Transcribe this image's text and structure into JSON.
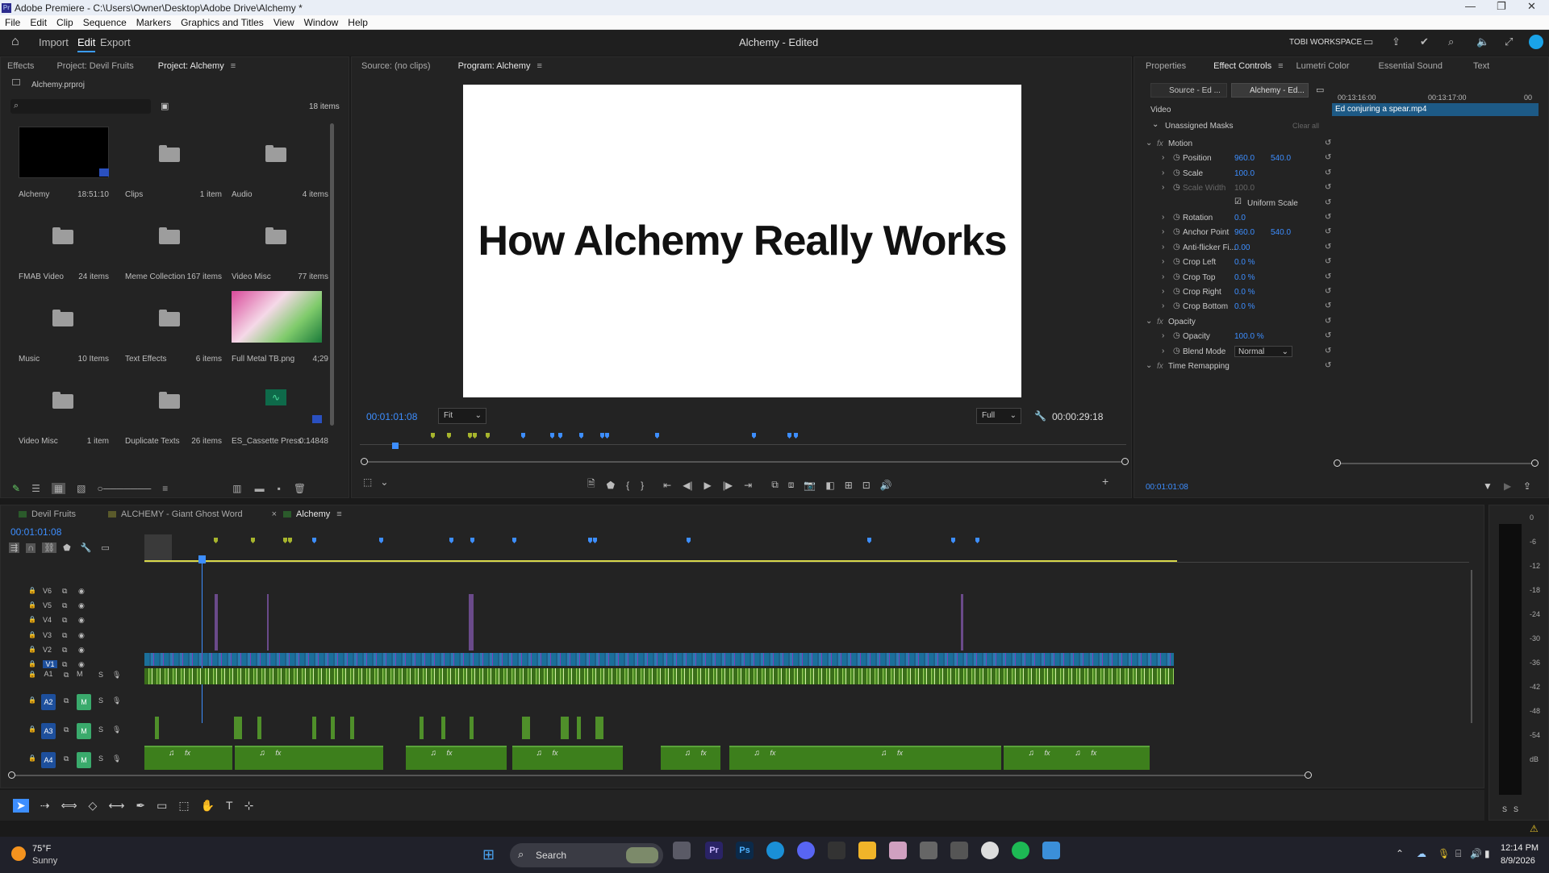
{
  "window": {
    "title": "Adobe Premiere - C:\\Users\\Owner\\Desktop\\Adobe Drive\\Alchemy *",
    "logo": "Pr"
  },
  "menu": [
    "File",
    "Edit",
    "Clip",
    "Sequence",
    "Markers",
    "Graphics and Titles",
    "View",
    "Window",
    "Help"
  ],
  "header": {
    "nav": [
      "Import",
      "Edit",
      "Export"
    ],
    "active": "Edit",
    "center": "Alchemy - Edited",
    "workspace": "TOBI WORKSPACE"
  },
  "project": {
    "tabs": [
      "Effects",
      "Project: Devil Fruits",
      "Project: Alchemy"
    ],
    "file": "Alchemy.prproj",
    "search_placeholder": "",
    "count": "18 items",
    "items": [
      {
        "name": "Alchemy",
        "count": "18:51:10",
        "type": "sequence"
      },
      {
        "name": "Clips",
        "count": "1 item",
        "type": "folder"
      },
      {
        "name": "Audio",
        "count": "4 items",
        "type": "folder"
      },
      {
        "name": "FMAB Video",
        "count": "24 items",
        "type": "folder"
      },
      {
        "name": "Meme Collection",
        "count": "167 items",
        "type": "folder"
      },
      {
        "name": "Video Misc",
        "count": "77 items",
        "type": "folder"
      },
      {
        "name": "Music",
        "count": "10 Items",
        "type": "folder"
      },
      {
        "name": "Text Effects",
        "count": "6 items",
        "type": "folder"
      },
      {
        "name": "Full Metal TB.png",
        "count": "4;29",
        "type": "image"
      },
      {
        "name": "Video Misc",
        "count": "1 item",
        "type": "folder"
      },
      {
        "name": "Duplicate Texts",
        "count": "26 items",
        "type": "folder"
      },
      {
        "name": "ES_Cassette Press ...",
        "count": "0:14848",
        "type": "audio"
      }
    ]
  },
  "monitor": {
    "tabs": [
      "Source: (no clips)",
      "Program: Alchemy"
    ],
    "title_text": "How Alchemy Really Works",
    "timecode": "00:01:01:08",
    "fit": "Fit",
    "full": "Full",
    "duration": "00:00:29:18"
  },
  "effect_controls": {
    "tabs": [
      "Properties",
      "Effect Controls",
      "Lumetri Color",
      "Essential Sound",
      "Text"
    ],
    "source_btn": "Source - Ed ...",
    "seq_btn": "Alchemy - Ed...",
    "time1": "00:13:16:00",
    "time2": "00:13:17:00",
    "time3": "00",
    "clip": "Ed conjuring a spear.mp4",
    "section": "Video",
    "masks": "Unassigned Masks",
    "clear": "Clear all",
    "rows": [
      {
        "label": "Motion",
        "fx": true,
        "v1": "",
        "v2": ""
      },
      {
        "label": "Position",
        "v1": "960.0",
        "v2": "540.0"
      },
      {
        "label": "Scale",
        "v1": "100.0",
        "v2": ""
      },
      {
        "label": "Scale Width",
        "v1": "100.0",
        "v2": "",
        "dim": true
      },
      {
        "label": "Uniform Scale",
        "v1": "",
        "v2": "",
        "check": true
      },
      {
        "label": "Rotation",
        "v1": "0.0",
        "v2": ""
      },
      {
        "label": "Anchor Point",
        "v1": "960.0",
        "v2": "540.0"
      },
      {
        "label": "Anti-flicker Fi...",
        "v1": "0.00",
        "v2": ""
      },
      {
        "label": "Crop Left",
        "v1": "0.0 %",
        "v2": ""
      },
      {
        "label": "Crop Top",
        "v1": "0.0 %",
        "v2": ""
      },
      {
        "label": "Crop Right",
        "v1": "0.0 %",
        "v2": ""
      },
      {
        "label": "Crop Bottom",
        "v1": "0.0 %",
        "v2": ""
      },
      {
        "label": "Opacity",
        "fx": true,
        "v1": "",
        "v2": ""
      },
      {
        "label": "Opacity",
        "v1": "100.0 %",
        "v2": ""
      },
      {
        "label": "Blend Mode",
        "v1": "Normal",
        "v2": "",
        "select": true
      },
      {
        "label": "Time Remapping",
        "fx": true,
        "v1": "",
        "v2": ""
      }
    ],
    "footer_time": "00:01:01:08"
  },
  "timeline": {
    "tabs": [
      "Devil Fruits",
      "ALCHEMY - Giant Ghost Word",
      "Alchemy"
    ],
    "timecode": "00:01:01:08",
    "video_tracks": [
      "V6",
      "V5",
      "V4",
      "V3",
      "V2",
      "V1"
    ],
    "audio_tracks": [
      "A1",
      "A2",
      "A3",
      "A4"
    ],
    "m": "M",
    "s": "S"
  },
  "meter": {
    "labels": [
      "0",
      "-6",
      "-12",
      "-18",
      "-24",
      "-30",
      "-36",
      "-42",
      "-48",
      "-54",
      "dB"
    ],
    "s1": "S",
    "s2": "S"
  },
  "taskbar": {
    "temp": "75°F",
    "weather": "Sunny",
    "search": "Search",
    "time": "12:14 PM",
    "date": "8/9/2026"
  }
}
